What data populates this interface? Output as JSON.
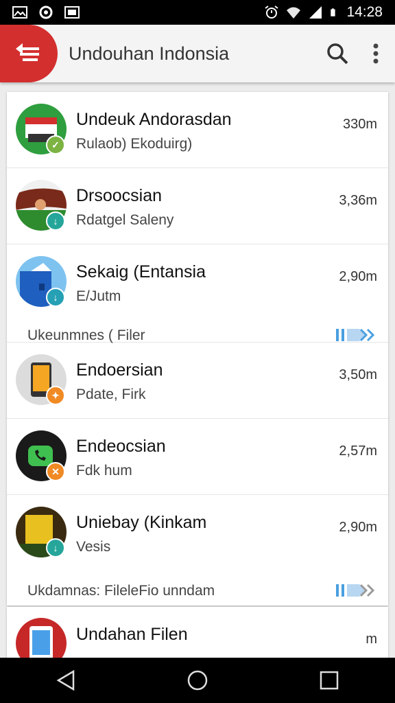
{
  "status_bar": {
    "time": "14:28",
    "left_icons": [
      "image-icon",
      "sync-icon",
      "photo-icon"
    ],
    "right_icons": [
      "alarm-icon",
      "wifi-icon",
      "signal-icon",
      "battery-icon"
    ]
  },
  "app_bar": {
    "title": "Undouhan Indonsia",
    "actions": [
      "search-icon",
      "more-vert-icon"
    ],
    "accent": "#d32f2f"
  },
  "downloads": [
    {
      "title": "Undeuk Andorasdan",
      "subtitle": "Rulaob) Ekoduirg)",
      "size": "330m",
      "badge_color": "#7cb342",
      "avatar_color": "#2e9e3e"
    },
    {
      "title": "Drsoocsian",
      "subtitle": "Rdatgel Saleny",
      "size": "3,36m",
      "badge_color": "#26a69a",
      "avatar_color": "#3b6b2a"
    },
    {
      "title": "Sekaig (Entansia",
      "subtitle": "E/Jutm",
      "size": "2,90m",
      "badge_color": "#26a0b5",
      "avatar_color": "#3f8fd8",
      "extra": "Ukeunmnes ( Filer"
    },
    {
      "title": "Endoersian",
      "subtitle": "Pdate, Firk",
      "size": "3,50m",
      "badge_color": "#f08a24",
      "avatar_color": "#d9d9d9"
    },
    {
      "title": "Endeocsian",
      "subtitle": "Fdk hum",
      "size": "2,57m",
      "badge_color": "#f08a24",
      "avatar_color": "#1a1a1a"
    },
    {
      "title": "Uniebay (Kinkam",
      "subtitle": "Vesis",
      "size": "2,90m",
      "badge_color": "#26a69a",
      "avatar_color": "#4a3a1a",
      "extra": "Ukdamnas: FileleFio unndam"
    },
    {
      "title": "Undahan Filen",
      "subtitle": "",
      "size": "m",
      "badge_color": "#26a69a",
      "avatar_color": "#c62828"
    }
  ],
  "nav_bar": {
    "buttons": [
      "back-icon",
      "home-icon",
      "recents-icon"
    ]
  }
}
